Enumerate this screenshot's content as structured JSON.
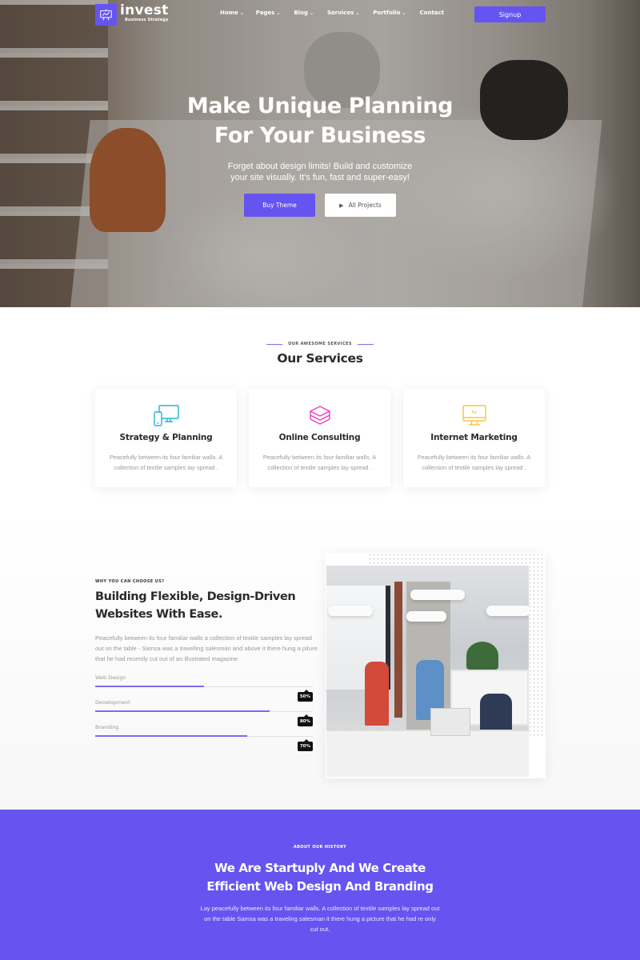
{
  "brand": {
    "name": "invest",
    "tagline": "Business Strategy"
  },
  "nav": {
    "items": [
      {
        "label": "Home",
        "has_dropdown": true
      },
      {
        "label": "Pages",
        "has_dropdown": true
      },
      {
        "label": "Blog",
        "has_dropdown": true
      },
      {
        "label": "Services",
        "has_dropdown": true
      },
      {
        "label": "Portfolio",
        "has_dropdown": true
      },
      {
        "label": "Contact",
        "has_dropdown": false
      }
    ],
    "signup_label": "Signup"
  },
  "hero": {
    "title_line1": "Make Unique Planning",
    "title_line2": "For Your Business",
    "subtitle_line1": "Forget about design limits! Build and customize",
    "subtitle_line2": "your site visually. It's fun, fast and super-easy!",
    "primary_button": "Buy Theme",
    "secondary_button": "All Projects"
  },
  "services": {
    "eyebrow": "Our Awesome Services",
    "title": "Our Services",
    "cards": [
      {
        "icon": "devices-icon",
        "title": "Strategy & Planning",
        "text": "Peacefully between its four familiar walls. A collection of textile samples lay spread .",
        "color": "#27b3d3"
      },
      {
        "icon": "layers-icon",
        "title": "Online Consulting",
        "text": "Peacefully between its four familiar walls. A collection of textile samples lay spread .",
        "color": "#ee3bc4"
      },
      {
        "icon": "monitor-icon",
        "title": "Internet Marketing",
        "text": "Peacefully between its four familiar walls. A collection of textile samples lay spread .",
        "color": "#f6c545"
      }
    ]
  },
  "why": {
    "eyebrow": "Why You Can Choose Us?",
    "title_line1": "Building Flexible, Design-Driven",
    "title_line2": "Websites With Ease.",
    "text": "Peacefully between its four familiar walls a collection of textile samples lay spread out on the table - Samsa was a travelling salesman and above it there hung a piture that he had recently cut out of an illustrated magazine",
    "skills": [
      {
        "label": "Web Design",
        "percent": 50,
        "badge": "50%"
      },
      {
        "label": "Development",
        "percent": 80,
        "badge": "80%"
      },
      {
        "label": "Branding",
        "percent": 70,
        "badge": "70%"
      }
    ]
  },
  "history": {
    "eyebrow": "About Our History",
    "title_line1": "We Are Startuply And We Create",
    "title_line2": "Efficient Web Design And Branding",
    "text": "Lay peacefully between its four familiar walls. A collection of textile samples lay spread out on the table Samsa was a traveling salesman it there hung a picture that he had re only cut out."
  },
  "colors": {
    "accent": "#6654f1",
    "heading": "#2b2b2b",
    "body_text": "#9a9a9a",
    "badge_bg": "#111111"
  }
}
